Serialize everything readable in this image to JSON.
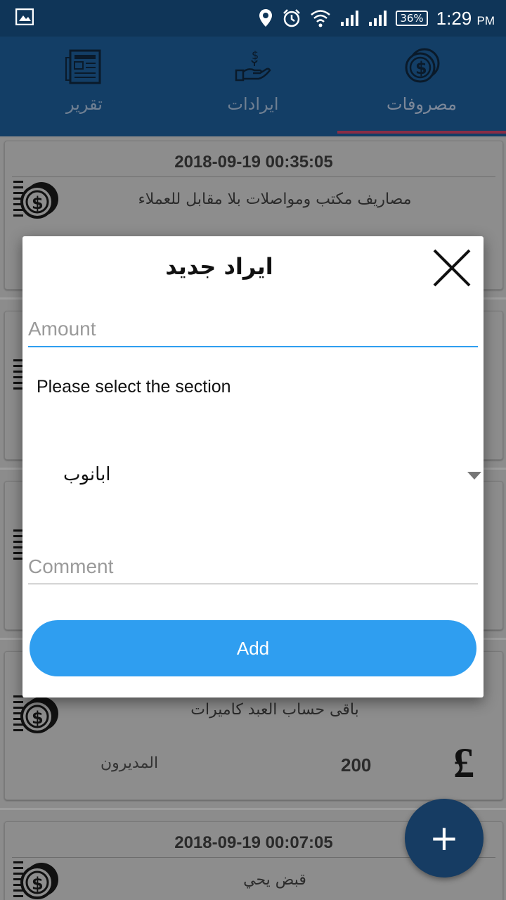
{
  "status_bar": {
    "time": "1:29",
    "ampm": "PM",
    "battery": "36%"
  },
  "tabs": [
    {
      "label": "تقرير",
      "icon": "report-icon"
    },
    {
      "label": "ايرادات",
      "icon": "income-hand-icon"
    },
    {
      "label": "مصروفات",
      "icon": "coins-icon",
      "active": true
    }
  ],
  "cards": [
    {
      "date": "2018-09-19 00:35:05",
      "description": "مصاريف مكتب ومواصلات بلا مقابل للعملاء"
    },
    {
      "date": "",
      "description": ""
    },
    {
      "date": "",
      "description": ""
    },
    {
      "date": "",
      "description": "باقى حساب العبد كاميرات",
      "amount": "200",
      "owner": "المديرون",
      "currency": "£"
    },
    {
      "date": "2018-09-19 00:07:05",
      "description": "قبض يحي"
    }
  ],
  "fab": {
    "label": "+"
  },
  "dialog": {
    "title": "ايراد جديد",
    "amount_placeholder": "Amount",
    "section_label": "Please select the section",
    "section_value": "ابانوب",
    "comment_placeholder": "Comment",
    "add_label": "Add"
  },
  "colors": {
    "status_bar": "#0f3558",
    "app_bar": "#133e66",
    "tab_indicator": "#8a2d45",
    "accent_blue": "#2f9ef0",
    "fab": "#163c63"
  }
}
